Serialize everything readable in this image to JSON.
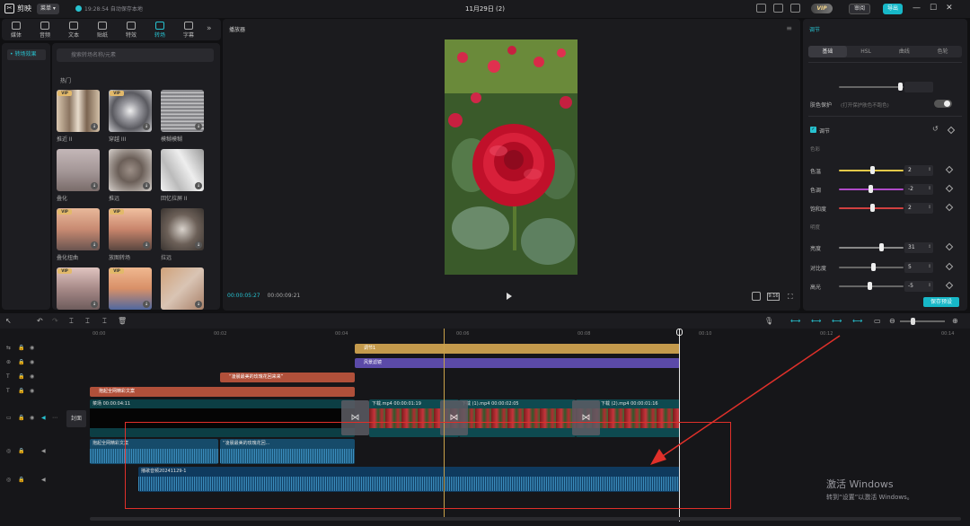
{
  "app": {
    "name": "剪映",
    "menu": "菜单",
    "autosave": "19:28:54 自动保存本地",
    "project_title": "11月29日 (2)",
    "vip": "VIP",
    "share": "审阅",
    "export": "导出"
  },
  "toolbar": [
    {
      "label": "媒体"
    },
    {
      "label": "音频"
    },
    {
      "label": "文本"
    },
    {
      "label": "贴纸"
    },
    {
      "label": "特效"
    },
    {
      "label": "转场"
    },
    {
      "label": "字幕"
    }
  ],
  "sidebar": {
    "category": "• 转场效果"
  },
  "library": {
    "search_placeholder": "搜索转场名称/元素",
    "section": "热门",
    "items": [
      {
        "label": "推近 II",
        "vip": "VIP"
      },
      {
        "label": "穿越 III",
        "vip": "VIP"
      },
      {
        "label": "模糊模糊",
        "vip": ""
      },
      {
        "label": "叠化",
        "vip": ""
      },
      {
        "label": "推远",
        "vip": ""
      },
      {
        "label": "回忆拉屏 II",
        "vip": ""
      },
      {
        "label": "叠化扭曲",
        "vip": "VIP"
      },
      {
        "label": "放图转场",
        "vip": "VIP"
      },
      {
        "label": "拉远",
        "vip": ""
      },
      {
        "label": "",
        "vip": "VIP"
      },
      {
        "label": "",
        "vip": "VIP"
      },
      {
        "label": "",
        "vip": ""
      }
    ]
  },
  "player": {
    "title": "播放器",
    "current": "00:00:05:27",
    "total": "00:00:09:21",
    "ratio": "9:16"
  },
  "adjust": {
    "title": "调节",
    "tabs": [
      "基础",
      "HSL",
      "曲线",
      "色轮"
    ],
    "skin_protect": "肤色保护",
    "skin_hint": "(打开保护肤色不跑色)",
    "section": "调节",
    "color_group": "色彩",
    "light_group": "明度",
    "sliders": [
      {
        "label": "色温",
        "value": "2",
        "pos": 0.52,
        "color": "#e3c94a"
      },
      {
        "label": "色调",
        "value": "-2",
        "pos": 0.48,
        "color": "#b04ac8"
      },
      {
        "label": "饱和度",
        "value": "2",
        "pos": 0.52,
        "color": "#d04040"
      },
      {
        "label": "亮度",
        "value": "31",
        "pos": 0.65,
        "color": "#888888"
      },
      {
        "label": "对比度",
        "value": "5",
        "pos": 0.53,
        "color": "#666666"
      },
      {
        "label": "高光",
        "value": "-5",
        "pos": 0.47,
        "color": "#666666"
      }
    ],
    "save_preset": "保存预设"
  },
  "timeline": {
    "ticks": [
      "00:00",
      "00:02",
      "00:04",
      "00:06",
      "00:08",
      "00:10",
      "00:12",
      "00:14"
    ],
    "cover": "封面",
    "clips": {
      "adjust": "调节1",
      "filter": "风景滤镜",
      "text1": "“凌晨最美的玫瑰花回来来”",
      "text2": "抱起全网精彩文案",
      "main": "菜场  00:00:04:11",
      "v1": "下载.mp4  00:00:01:19",
      "v2": "下载 (1).mp4  00:00:02:05",
      "v3": "下载 (2).mp4  00:00:01:16",
      "a1": "抱起全网精彩文案",
      "a2": "“凌晨最美的玫瑰花回...",
      "music": "播歌音频20241129-1"
    }
  },
  "watermark": {
    "line1": "激活 Windows",
    "line2": "转到“设置”以激活 Windows。"
  }
}
